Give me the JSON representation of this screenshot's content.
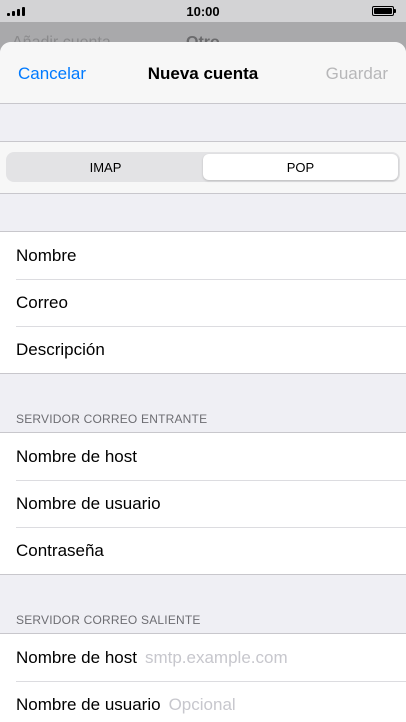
{
  "status_bar": {
    "time": "10:00"
  },
  "background_nav": {
    "back_label": "Añadir cuenta",
    "title": "Otro"
  },
  "navbar": {
    "cancel_label": "Cancelar",
    "title": "Nueva cuenta",
    "save_label": "Guardar"
  },
  "segmented": {
    "options": [
      "IMAP",
      "POP"
    ],
    "selected": "POP"
  },
  "account": {
    "name_label": "Nombre",
    "email_label": "Correo",
    "description_label": "Descripción"
  },
  "incoming": {
    "header": "SERVIDOR CORREO ENTRANTE",
    "host_label": "Nombre de host",
    "user_label": "Nombre de usuario",
    "password_label": "Contraseña"
  },
  "outgoing": {
    "header": "SERVIDOR CORREO SALIENTE",
    "host_label": "Nombre de host",
    "host_placeholder": "smtp.example.com",
    "user_label": "Nombre de usuario",
    "user_placeholder": "Opcional"
  }
}
